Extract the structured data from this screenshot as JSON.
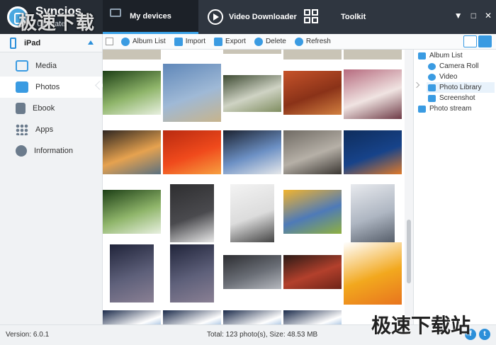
{
  "app": {
    "name": "Syncios",
    "edition": "Ultimate"
  },
  "watermark": {
    "top": "极速下载站",
    "bottom": "极速下载站"
  },
  "nav": {
    "my_devices": "My devices",
    "video_downloader": "Video Downloader",
    "toolkit": "Toolkit"
  },
  "window_controls": {
    "menu": "▼",
    "minimize": "□",
    "close": "✕"
  },
  "device": {
    "name": "iPad"
  },
  "sidebar": {
    "items": [
      {
        "label": "Media",
        "icon": "media-icon",
        "color": "#3a9be2"
      },
      {
        "label": "Photos",
        "icon": "photos-icon",
        "color": "#3a9be2",
        "active": true
      },
      {
        "label": "Ebook",
        "icon": "ebook-icon",
        "color": "#6b7b8c"
      },
      {
        "label": "Apps",
        "icon": "apps-icon",
        "color": "#6b7b8c"
      },
      {
        "label": "Information",
        "icon": "information-icon",
        "color": "#6b7b8c"
      }
    ]
  },
  "toolbar": {
    "album_list": "Album List",
    "import": "Import",
    "export": "Export",
    "delete": "Delete",
    "refresh": "Refresh"
  },
  "tree": {
    "album_list": "Album List",
    "camera_roll": "Camera Roll",
    "video": "Video",
    "photo_library": "Photo Library",
    "screenshot": "Screenshot",
    "photo_stream": "Photo stream"
  },
  "photos": [
    {
      "name": "hydrangea",
      "colors": [
        "#1d3f16",
        "#8fb56a",
        "#e8f0e0"
      ]
    },
    {
      "name": "city-tower",
      "colors": [
        "#5f87b9",
        "#9fb9d6",
        "#c7b48c"
      ]
    },
    {
      "name": "room-plants",
      "colors": [
        "#3d4a32",
        "#cfd3c4",
        "#7f8d60"
      ]
    },
    {
      "name": "desert-butte",
      "colors": [
        "#c6532a",
        "#8a3218",
        "#d28040"
      ]
    },
    {
      "name": "candy-cup",
      "colors": [
        "#b66a7e",
        "#f0e4e2",
        "#6e3a46"
      ]
    },
    {
      "name": "lighthouse-sunset",
      "colors": [
        "#2e2620",
        "#e6a24f",
        "#5a7080"
      ]
    },
    {
      "name": "red-flower",
      "colors": [
        "#b82a10",
        "#f04a1c",
        "#f7a040"
      ]
    },
    {
      "name": "penguins",
      "colors": [
        "#1b2230",
        "#6c90c4",
        "#e6e8ea"
      ]
    },
    {
      "name": "koala",
      "colors": [
        "#6f6a63",
        "#b6b0a7",
        "#3a3632"
      ]
    },
    {
      "name": "jellyfish",
      "colors": [
        "#0e2d5c",
        "#17438a",
        "#e07a2a"
      ]
    },
    {
      "name": "hydrangea-2",
      "colors": [
        "#1d3f16",
        "#8fb56a",
        "#e8f0e0"
      ]
    },
    {
      "name": "keyboard",
      "colors": [
        "#2e2e30",
        "#4a4a4e",
        "#e8e8e8"
      ]
    },
    {
      "name": "phone-desk",
      "colors": [
        "#f3f3f3",
        "#dcdcdc",
        "#444444"
      ]
    },
    {
      "name": "tulips",
      "colors": [
        "#f2b42e",
        "#4e7ab8",
        "#8fb040"
      ]
    },
    {
      "name": "mask",
      "colors": [
        "#e8eaee",
        "#aeb6c2",
        "#565e6a"
      ]
    },
    {
      "name": "lockscreen-1",
      "colors": [
        "#20243a",
        "#5e607a",
        "#8a8094"
      ]
    },
    {
      "name": "lockscreen-2",
      "colors": [
        "#20243a",
        "#5e607a",
        "#8a8094"
      ]
    },
    {
      "name": "phone-back",
      "colors": [
        "#2c2d31",
        "#6a6e76",
        "#b5b8be"
      ]
    },
    {
      "name": "leather-phone",
      "colors": [
        "#2a1a16",
        "#b3402c",
        "#6e2418"
      ]
    },
    {
      "name": "headphones",
      "colors": [
        "#ffffff",
        "#f2a81e",
        "#e8741e"
      ]
    },
    {
      "name": "desktop-1",
      "colors": [
        "#1a2a4a",
        "#ffffff",
        "#2d6fb8"
      ]
    },
    {
      "name": "desktop-2",
      "colors": [
        "#1a2a4a",
        "#ffffff",
        "#2d6fb8"
      ]
    },
    {
      "name": "desktop-3",
      "colors": [
        "#1a2a4a",
        "#ffffff",
        "#2d6fb8"
      ]
    },
    {
      "name": "desktop-4",
      "colors": [
        "#1a2a4a",
        "#ffffff",
        "#2d6fb8"
      ]
    }
  ],
  "status": {
    "version": "Version: 6.0.1",
    "total": "Total: 123 photo(s), Size: 48.53 MB"
  },
  "social": {
    "facebook": "f",
    "twitter": "t"
  }
}
